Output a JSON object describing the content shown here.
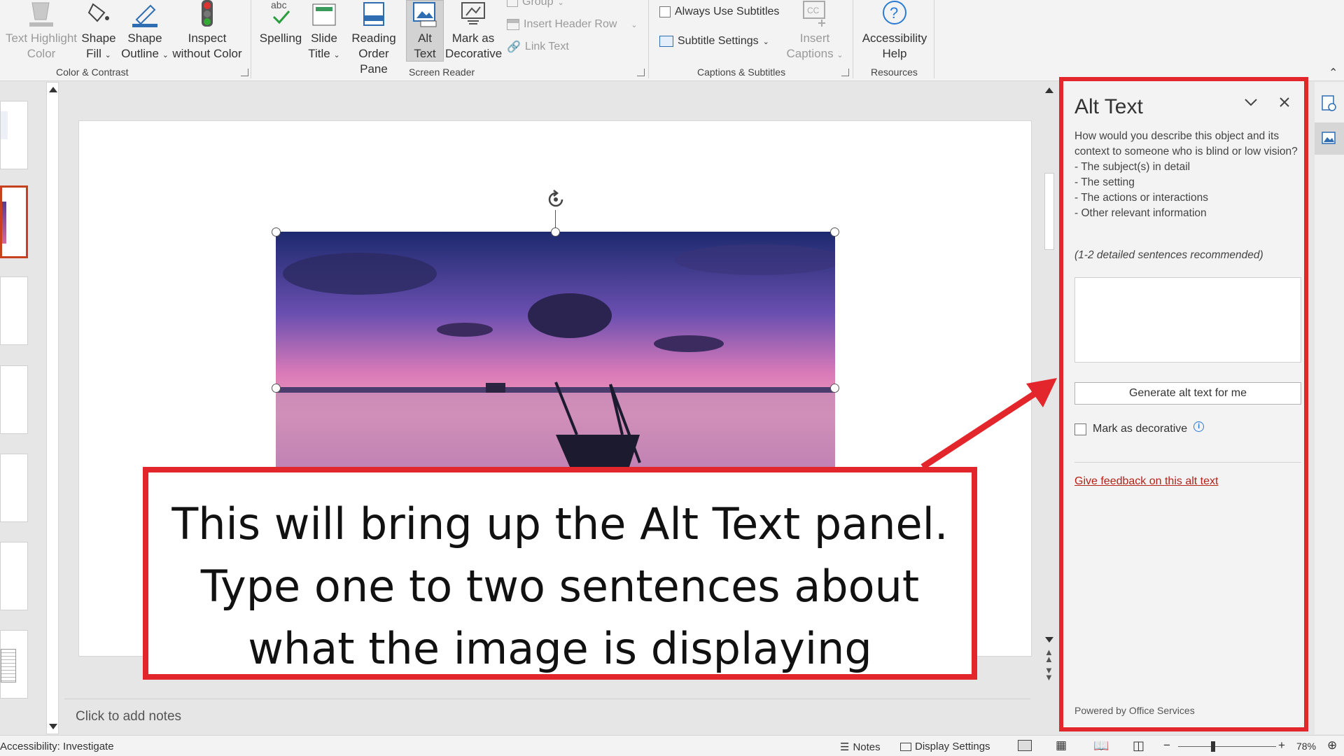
{
  "ribbon": {
    "text_highlight_color": [
      "Text Highlight",
      "Color"
    ],
    "shape_fill": [
      "Shape",
      "Fill"
    ],
    "shape_outline": [
      "Shape",
      "Outline"
    ],
    "inspect_without_color": [
      "Inspect",
      "without Color"
    ],
    "spelling": "Spelling",
    "slide_title": [
      "Slide",
      "Title"
    ],
    "reading_order_pane": [
      "Reading",
      "Order Pane"
    ],
    "alt_text": [
      "Alt",
      "Text"
    ],
    "mark_as_decorative": [
      "Mark as",
      "Decorative"
    ],
    "group": "Group",
    "insert_header_row": "Insert Header Row",
    "link_text": "Link Text",
    "always_use_subtitles": "Always Use Subtitles",
    "subtitle_settings": "Subtitle Settings",
    "insert_captions": [
      "Insert",
      "Captions"
    ],
    "accessibility_help": [
      "Accessibility",
      "Help"
    ],
    "groups": {
      "color_contrast": "Color & Contrast",
      "screen_reader": "Screen Reader",
      "captions_subtitles": "Captions & Subtitles",
      "resources": "Resources"
    }
  },
  "notes_placeholder": "Click to add notes",
  "alt_text_pane": {
    "title": "Alt Text",
    "description": "How would you describe this object and its context to someone who is blind or low vision?\n- The subject(s) in detail\n- The setting\n- The actions or interactions\n- Other relevant information",
    "hint": "(1-2 detailed sentences recommended)",
    "textarea_value": "",
    "generate_button": "Generate alt text for me",
    "decorative_label": "Mark as decorative",
    "feedback_link": "Give feedback on this alt text",
    "powered_by": "Powered by Office Services"
  },
  "callout": {
    "lines": [
      "This will bring up the Alt Text panel.",
      "Type one to two sentences about",
      "what the image is displaying"
    ]
  },
  "status_bar": {
    "accessibility": "Accessibility: Investigate",
    "notes": "Notes",
    "display_settings": "Display Settings",
    "zoom": "78%"
  },
  "colors": {
    "highlight_red": "#e3262b",
    "ribbon_bg": "#f3f3f3",
    "link_red": "#b52218",
    "accent_blue": "#2b7bd3"
  }
}
